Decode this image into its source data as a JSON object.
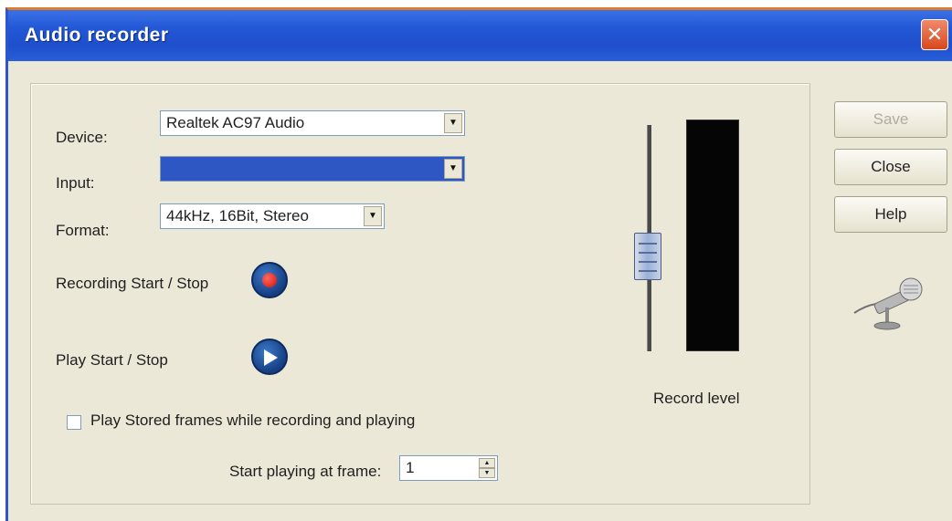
{
  "window": {
    "title": "Audio recorder",
    "close_glyph": "✕"
  },
  "form": {
    "device_label": "Device:",
    "device_value": "Realtek AC97 Audio",
    "input_label": "Input:",
    "input_value": "",
    "format_label": "Format:",
    "format_value": "44kHz, 16Bit, Stereo",
    "recording_label": "Recording Start / Stop",
    "play_label": "Play Start / Stop",
    "checkbox_label": "Play Stored frames while recording and playing",
    "checkbox_checked": false,
    "start_frame_label": "Start playing at frame:",
    "start_frame_value": "1"
  },
  "level": {
    "label": "Record level",
    "slider_level": 0.4
  },
  "buttons": {
    "save": "Save",
    "close": "Close",
    "help": "Help"
  },
  "icons": {
    "dropdown_arrow": "▼",
    "spin_up": "▲",
    "spin_down": "▼",
    "record": "record-icon",
    "play": "play-icon",
    "microphone": "microphone-icon"
  },
  "colors": {
    "titlebar": "#2357d6",
    "selection": "#2e57c4",
    "record_dot": "#d01010",
    "meter_bg": "#050505"
  }
}
